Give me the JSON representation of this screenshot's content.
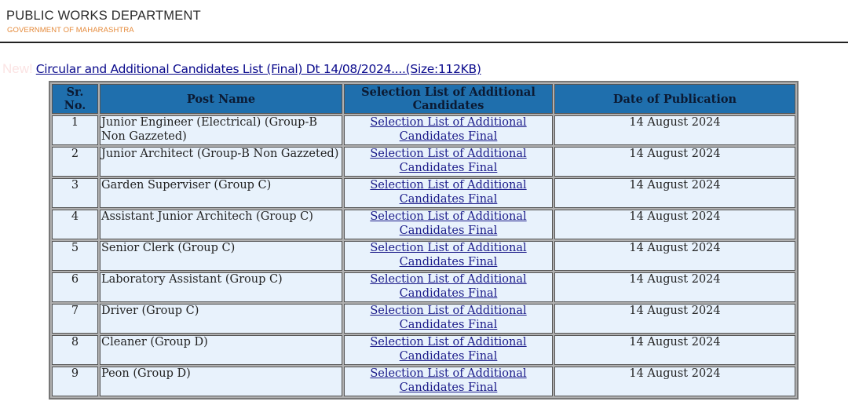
{
  "header": {
    "title": "PUBLIC WORKS DEPARTMENT",
    "subtitle": "GOVERNMENT OF MAHARASHTRA"
  },
  "notice": {
    "badge": "New!",
    "link_text": "Circular and Additional Candidates List (Final) Dt 14/08/2024....(Size:112KB)"
  },
  "colors": {
    "header_bg": "#1f6fad",
    "row_bg": "#e8f2fc",
    "subtitle": "#e58a3a",
    "link": "#1b1b8a"
  },
  "table": {
    "columns": [
      "Sr. No.",
      "Post Name",
      "Selection List of Additional Candidates",
      "Date of Publication"
    ],
    "rows": [
      {
        "sr": "1",
        "post": "Junior Engineer (Electrical) (Group-B Non Gazzeted)",
        "link": "Selection List of Additional Candidates Final",
        "date": "14 August 2024"
      },
      {
        "sr": "2",
        "post": "Junior Architect (Group-B Non Gazzeted)",
        "link": "Selection List of Additional Candidates Final",
        "date": "14 August 2024"
      },
      {
        "sr": "3",
        "post": "Garden Superviser (Group C)",
        "link": "Selection List of Additional Candidates Final",
        "date": "14 August 2024"
      },
      {
        "sr": "4",
        "post": "Assistant Junior Architech (Group C)",
        "link": "Selection List of Additional Candidates Final",
        "date": "14 August 2024"
      },
      {
        "sr": "5",
        "post": "Senior Clerk (Group C)",
        "link": "Selection List of Additional Candidates Final",
        "date": "14 August 2024"
      },
      {
        "sr": "6",
        "post": "Laboratory Assistant (Group C)",
        "link": "Selection List of Additional Candidates Final",
        "date": "14 August 2024"
      },
      {
        "sr": "7",
        "post": "Driver (Group C)",
        "link": "Selection List of Additional Candidates Final",
        "date": "14 August 2024"
      },
      {
        "sr": "8",
        "post": "Cleaner (Group D)",
        "link": "Selection List of Additional Candidates Final",
        "date": "14 August 2024"
      },
      {
        "sr": "9",
        "post": "Peon (Group D)",
        "link": "Selection List of Additional Candidates Final",
        "date": "14 August 2024"
      }
    ]
  }
}
